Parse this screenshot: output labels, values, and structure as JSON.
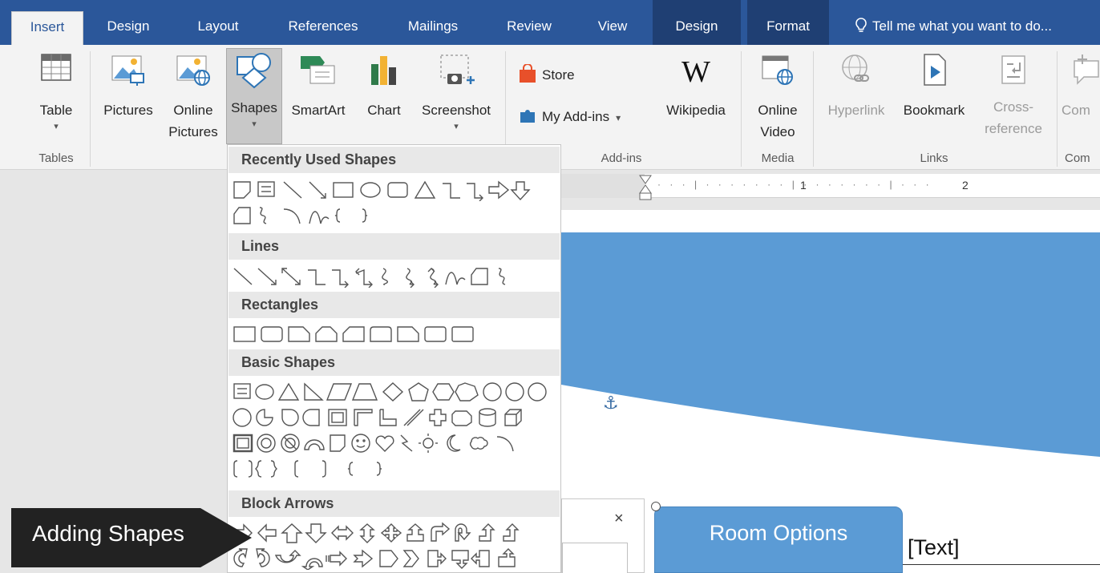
{
  "tabs": [
    {
      "label": "Insert",
      "active": true
    },
    {
      "label": "Design"
    },
    {
      "label": "Layout"
    },
    {
      "label": "References"
    },
    {
      "label": "Mailings"
    },
    {
      "label": "Review"
    },
    {
      "label": "View"
    },
    {
      "label": "Design",
      "contextual": true
    },
    {
      "label": "Format",
      "contextual": true
    }
  ],
  "tell_me": "Tell me what you want to do...",
  "ribbon": {
    "table": {
      "label": "Table"
    },
    "pictures": {
      "label": "Pictures"
    },
    "online_pictures": {
      "label_1": "Online",
      "label_2": "Pictures"
    },
    "shapes": {
      "label": "Shapes"
    },
    "smartart": {
      "label": "SmartArt"
    },
    "chart": {
      "label": "Chart"
    },
    "screenshot": {
      "label": "Screenshot"
    },
    "store": {
      "label": "Store"
    },
    "my_addins": {
      "label": "My Add-ins"
    },
    "wikipedia": {
      "label": "Wikipedia",
      "icon_glyph": "W"
    },
    "online_video": {
      "label_1": "Online",
      "label_2": "Video"
    },
    "hyperlink": {
      "label": "Hyperlink"
    },
    "bookmark": {
      "label": "Bookmark"
    },
    "cross_reference": {
      "label_1": "Cross-",
      "label_2": "reference"
    },
    "comment": {
      "label": "Com"
    },
    "groups": {
      "tables": "Tables",
      "addins": "Add-ins",
      "media": "Media",
      "links": "Links",
      "comments": "Com"
    }
  },
  "shapes_menu": {
    "recent": "Recently Used Shapes",
    "lines": "Lines",
    "rectangles": "Rectangles",
    "basic": "Basic Shapes",
    "block_arrows": "Block Arrows"
  },
  "ruler": {
    "mark_1": "1",
    "mark_2": "2"
  },
  "document": {
    "close_glyph": "×",
    "room_options": "Room Options",
    "text_placeholder": "[Text]",
    "anchor_glyph": "⚓"
  },
  "callout": {
    "label": "Adding Shapes"
  },
  "colors": {
    "ribbon_blue": "#2b579a",
    "banner_blue": "#5b9bd5",
    "callout_dark": "#222222"
  }
}
